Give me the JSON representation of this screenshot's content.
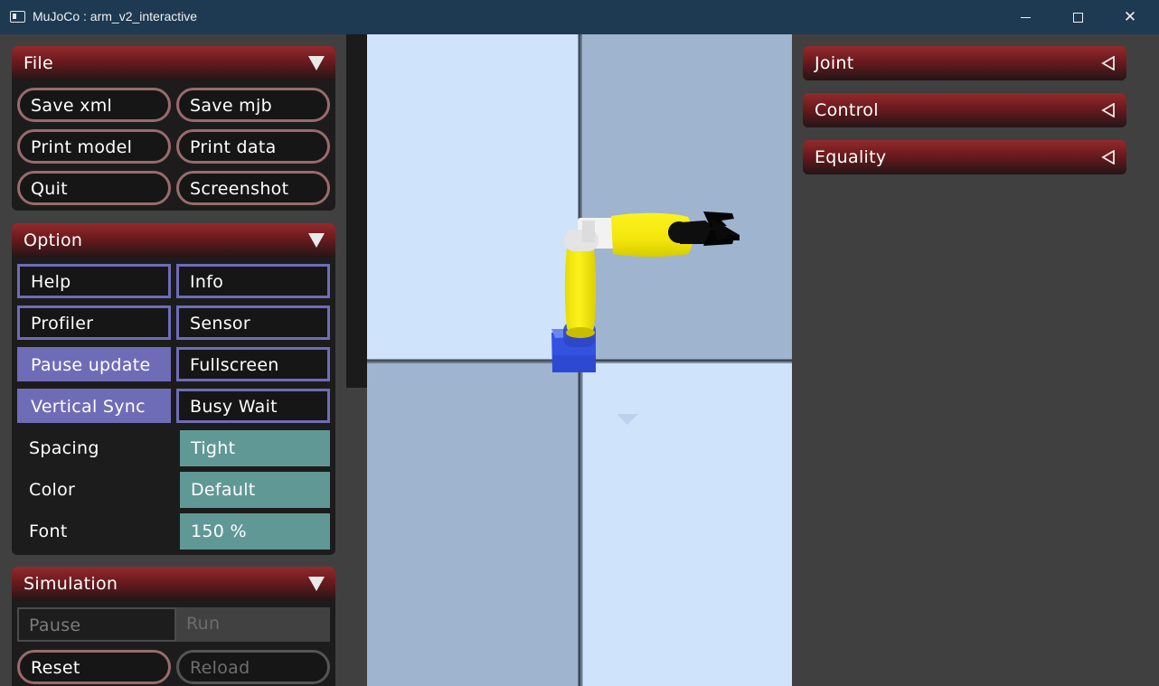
{
  "window": {
    "title": "MuJoCo : arm_v2_interactive",
    "min_glyph": "minimize-icon",
    "max_glyph": "maximize-icon",
    "close_glyph": "✕"
  },
  "file": {
    "title": "File",
    "buttons": [
      "Save xml",
      "Save mjb",
      "Print model",
      "Print data",
      "Quit",
      "Screenshot"
    ]
  },
  "option": {
    "title": "Option",
    "toggles": [
      {
        "label": "Help",
        "on": false
      },
      {
        "label": "Info",
        "on": false
      },
      {
        "label": "Profiler",
        "on": false
      },
      {
        "label": "Sensor",
        "on": false
      },
      {
        "label": "Pause update",
        "on": true
      },
      {
        "label": "Fullscreen",
        "on": false
      },
      {
        "label": "Vertical Sync",
        "on": true
      },
      {
        "label": "Busy Wait",
        "on": false
      }
    ],
    "settings": [
      {
        "label": "Spacing",
        "value": "Tight"
      },
      {
        "label": "Color",
        "value": "Default"
      },
      {
        "label": "Font",
        "value": "150 %"
      }
    ]
  },
  "simulation": {
    "title": "Simulation",
    "pause": "Pause",
    "run": "Run",
    "reset": "Reset",
    "reload": "Reload"
  },
  "right_panels": [
    {
      "title": "Joint"
    },
    {
      "title": "Control"
    },
    {
      "title": "Equality"
    }
  ],
  "colors": {
    "section_header": "#932a2c",
    "toggle_border": "#6f6cb7",
    "select_bg": "#609896",
    "floor_light": "#cfe3fb",
    "floor_dark": "#9fb4cf",
    "arm_yellow": "#f5e80f",
    "arm_base": "#3a5fe0"
  }
}
